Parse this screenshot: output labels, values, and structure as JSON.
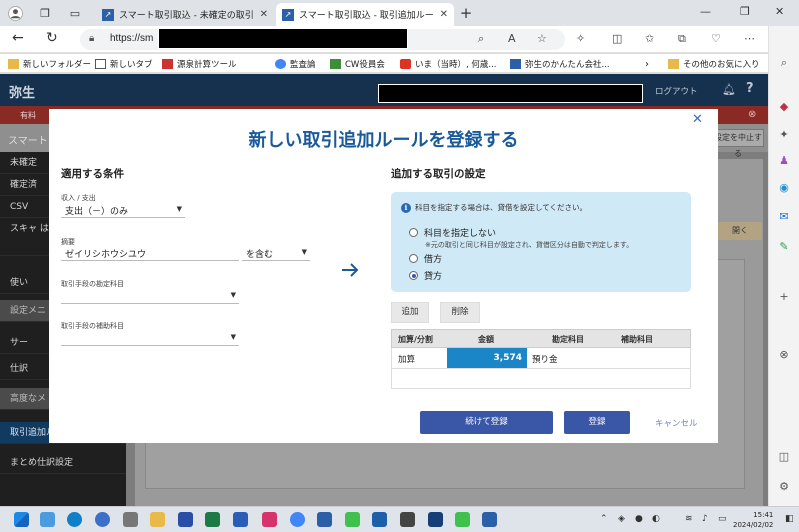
{
  "browser": {
    "tabs": [
      {
        "label": "スマート取引取込 - 未確定の取引"
      },
      {
        "label": "スマート取引取込 - 取引追加ルール登録"
      }
    ],
    "new_tab": "+",
    "url_prefix": "https://sm",
    "bookmarks": [
      "新しいフォルダー",
      "新しいタブ",
      "源泉計算ツール",
      "監査論",
      "CW役員会",
      "いま（当時）, 何歳...",
      "弥生のかんたん会社...",
      "その他のお気に入り"
    ]
  },
  "app": {
    "logo": "弥生",
    "logout": "ログアウト",
    "warning": "有料",
    "subtitle": "スマート",
    "cancel_setup": "設定を中止する",
    "right_pill": "開く",
    "nav": [
      {
        "label": "未確定"
      },
      {
        "label": "確定済"
      },
      {
        "label": "CSV"
      },
      {
        "label": "スキャ はじめ"
      },
      {
        "label": "使い"
      },
      {
        "label": "設定メニ",
        "section": true
      },
      {
        "label": "サー"
      },
      {
        "label": "仕訳"
      },
      {
        "label": "高度なメ",
        "section": true
      },
      {
        "label": "取引追加ルール設定",
        "active": true
      },
      {
        "label": "まとめ仕訳設定"
      }
    ]
  },
  "modal": {
    "title": "新しい取引追加ルールを登録する",
    "conditions": {
      "heading": "適用する条件",
      "income_label": "収入 / 支出",
      "income_value": "支出（－）のみ",
      "summary_label": "摘要",
      "summary_value": "ゼイリシホウシユウ",
      "match_value": "を含む",
      "account_label": "取引手段の勘定科目",
      "sub_account_label": "取引手段の補助科目"
    },
    "settings": {
      "heading": "追加する取引の設定",
      "info": "科目を指定する場合は、貸借を設定してください。",
      "options": [
        {
          "label": "科目を指定しない",
          "checked": false
        },
        {
          "label": "借方",
          "checked": false
        },
        {
          "label": "貸方",
          "checked": true
        }
      ],
      "note": "※元の取引と同じ科目が設定され、貸借区分は自動で判定します。",
      "add": "追加",
      "delete": "削除",
      "table": {
        "headers": [
          "加算/分割",
          "金額",
          "勘定科目",
          "補助科目"
        ],
        "rows": [
          [
            "加算",
            "3,574",
            "預り金",
            ""
          ]
        ]
      }
    },
    "continue_button": "続けて登録",
    "register_button": "登録",
    "cancel": "キャンセル"
  },
  "taskbar": {
    "time": "15:41",
    "date": "2024/02/02"
  }
}
